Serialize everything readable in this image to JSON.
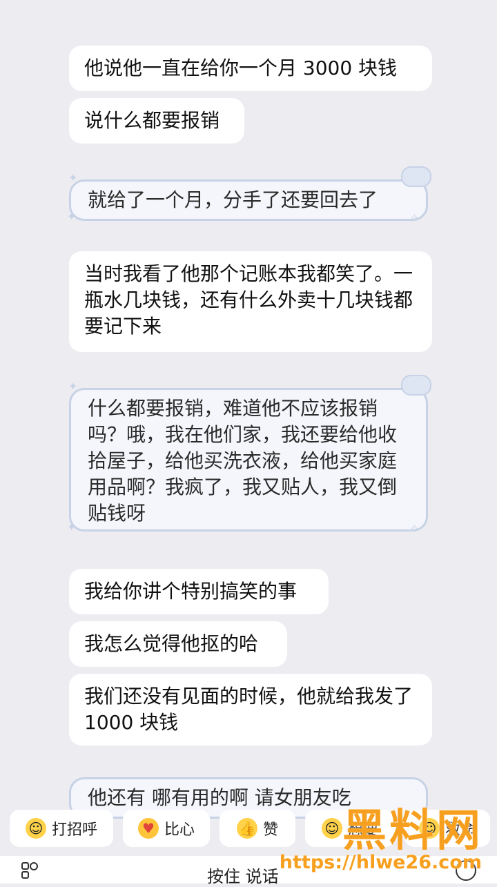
{
  "messages": [
    {
      "text": "他说他一直在给你一个月 3000 块钱"
    },
    {
      "text": "说什么都要报销"
    },
    {
      "text": "就给了一个月，分手了还要回去了"
    },
    {
      "text": "当时我看了他那个记账本我都笑了。一瓶水几块钱，还有什么外卖十几块钱都要记下来"
    },
    {
      "text": "什么都要报销，难道他不应该报销吗？哦，我在他们家，我还要给他收拾屋子，给他买洗衣液，给他买家庭用品啊？我疯了，我又贴人，我又倒贴钱呀"
    },
    {
      "text": "我给你讲个特别搞笑的事"
    },
    {
      "text": "我怎么觉得他抠的哈"
    },
    {
      "text": "我们还没有见面的时候，他就给我发了 1000 块钱"
    },
    {
      "text": "他还有 哪有用的啊 请女朋友吃"
    }
  ],
  "quick_replies": [
    {
      "label": "打招呼",
      "icon": "smile-face-icon"
    },
    {
      "label": "比心",
      "icon": "heart-hands-icon"
    },
    {
      "label": "赞",
      "icon": "thumbs-up-icon"
    },
    {
      "label": "想要",
      "icon": "emoji-icon"
    },
    {
      "label": "救命",
      "icon": "emoji-icon"
    }
  ],
  "input": {
    "placeholder": "按住 说话"
  },
  "watermark": {
    "logo": "黑料网",
    "url": "https://hlwe26.com"
  }
}
